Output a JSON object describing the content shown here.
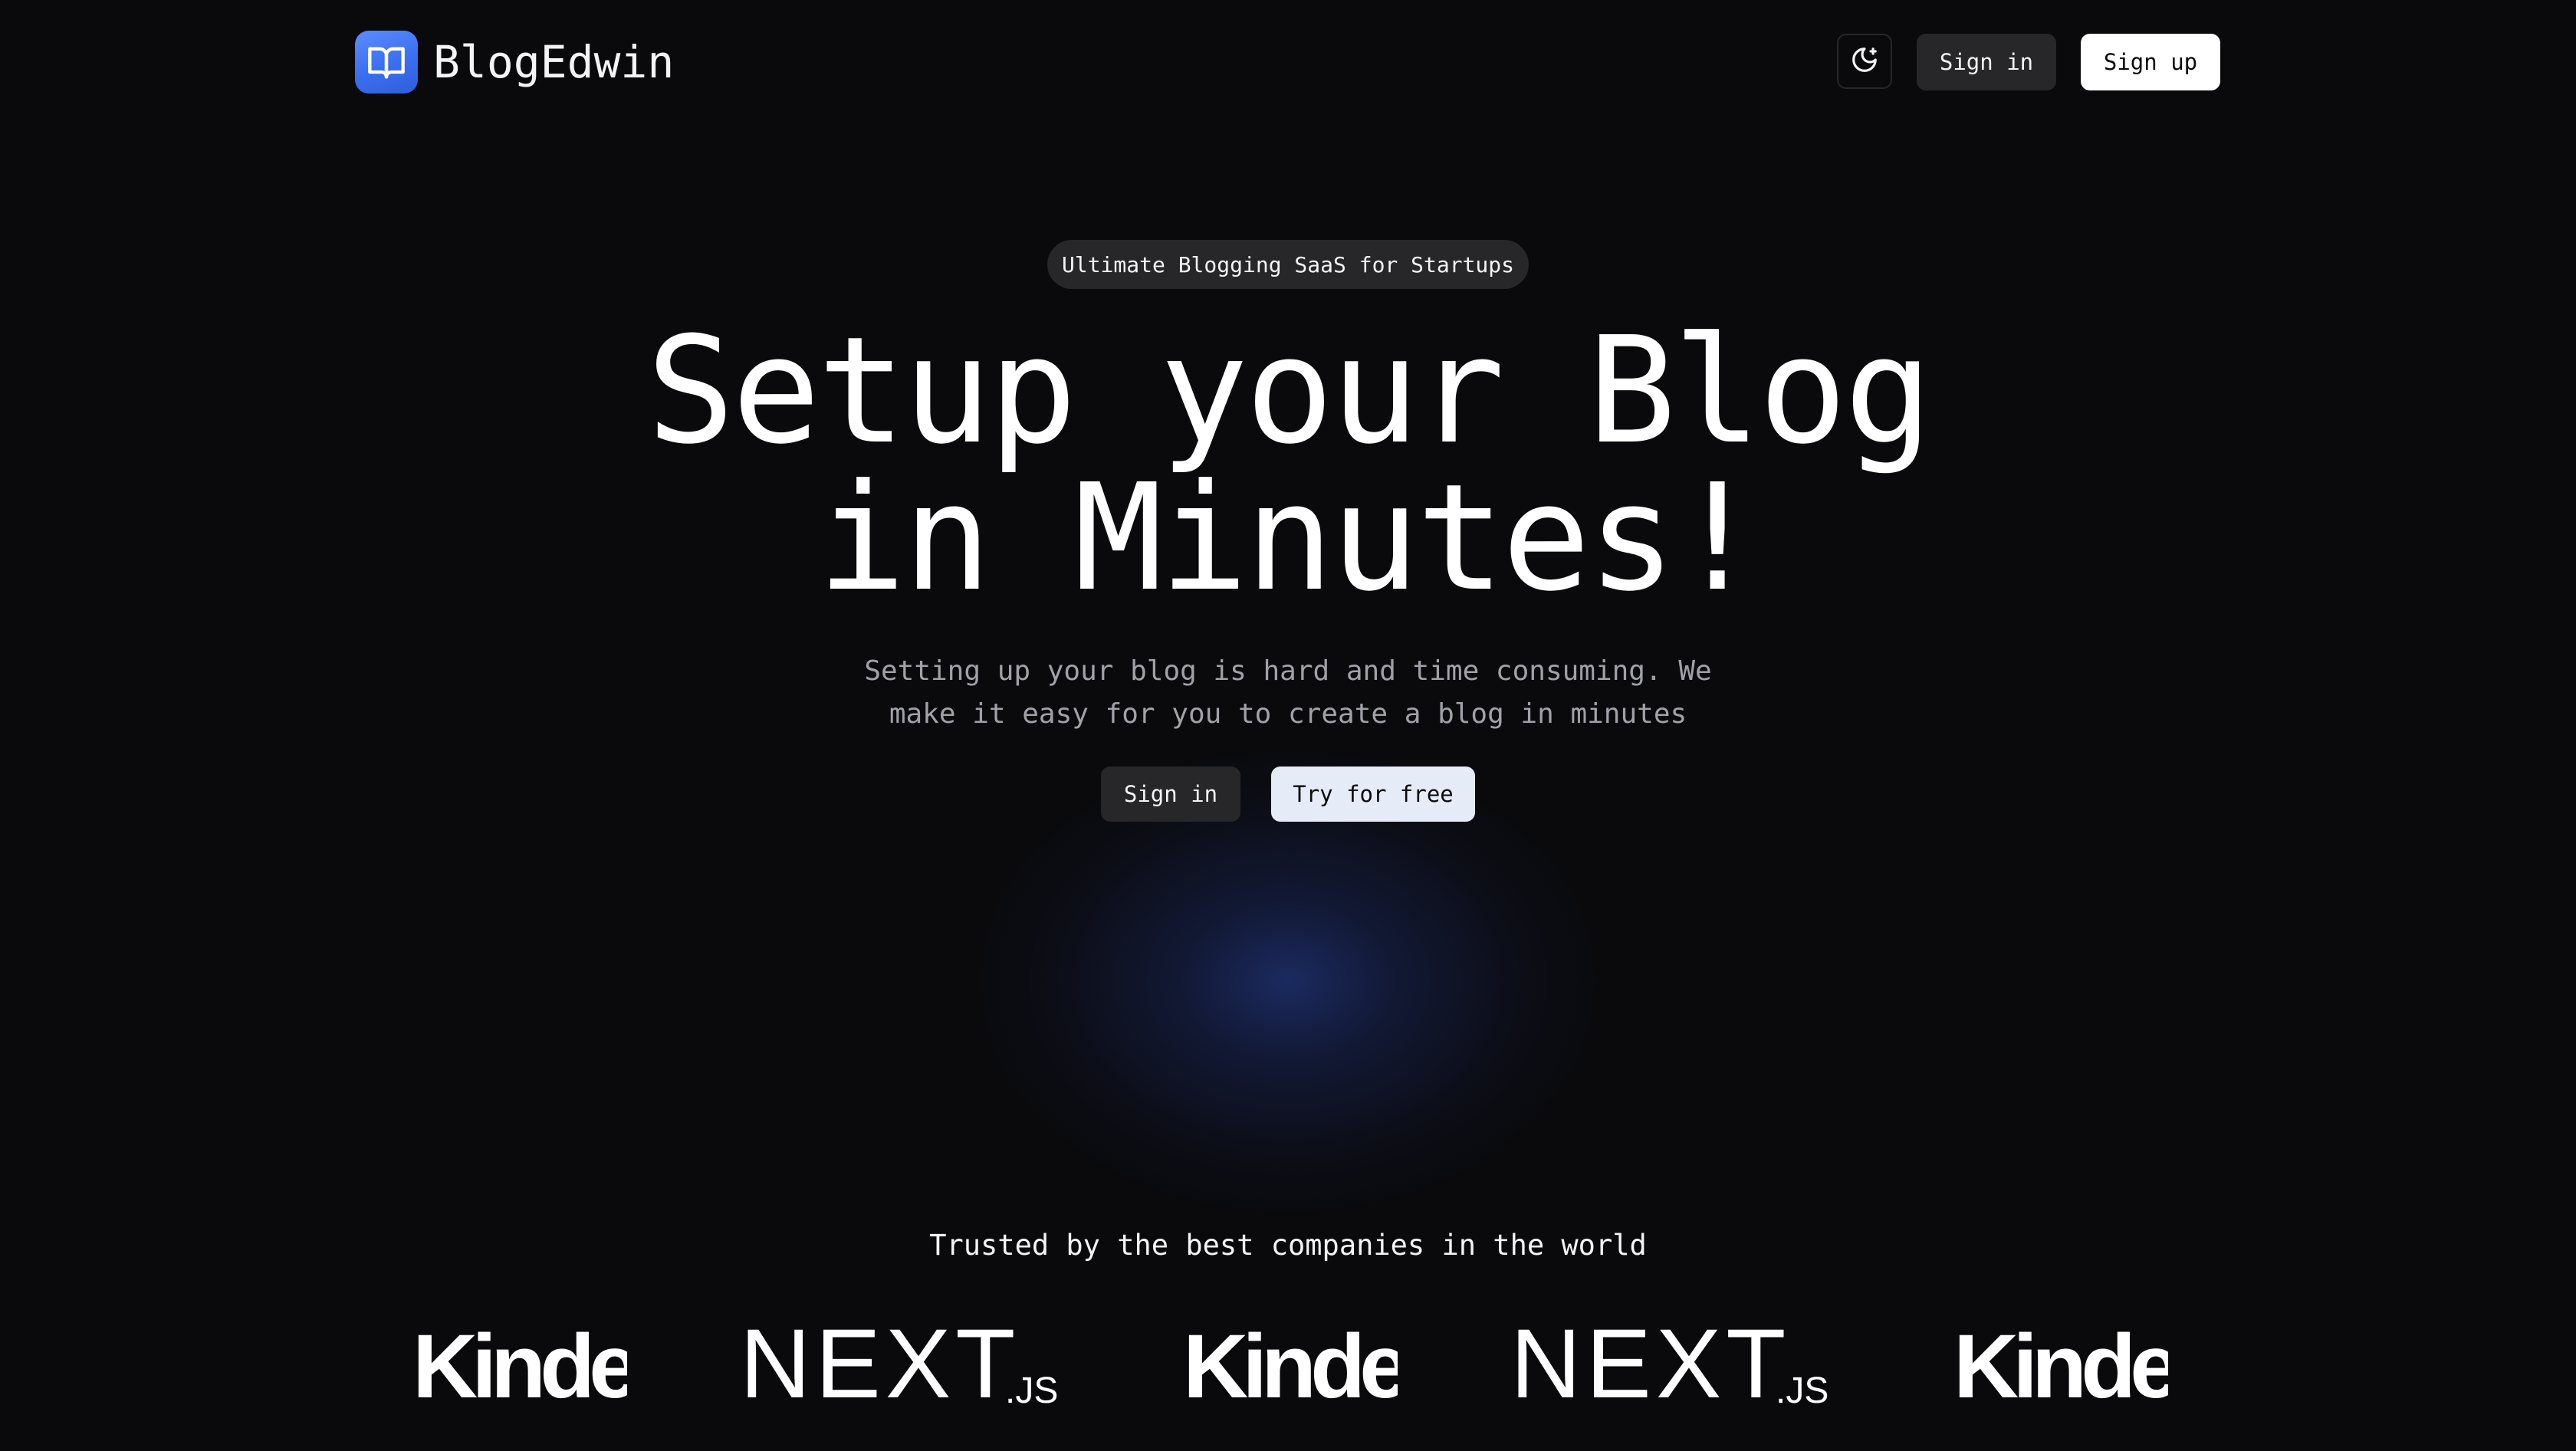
{
  "brand": {
    "name": "BlogEdwin",
    "logo_icon": "book-open-icon",
    "accent": "#3b6ef0"
  },
  "nav": {
    "theme_toggle_icon": "moon-stars-icon",
    "signin_label": "Sign in",
    "signup_label": "Sign up"
  },
  "hero": {
    "badge": "Ultimate Blogging SaaS for Startups",
    "headline_line1": "Setup your Blog",
    "headline_line2": "in Minutes!",
    "subtext": "Setting up your blog is hard and time consuming. We make it easy for you to create a blog in minutes",
    "signin_label": "Sign in",
    "try_label": "Try for free"
  },
  "trusted": {
    "heading": "Trusted by the best companies in the world",
    "logos": [
      {
        "name": "Kinde",
        "text": "Kinde"
      },
      {
        "name": "Next.js",
        "text": "NEXT",
        "suffix": ".JS"
      },
      {
        "name": "Kinde",
        "text": "Kinde"
      },
      {
        "name": "Next.js",
        "text": "NEXT",
        "suffix": ".JS"
      },
      {
        "name": "Kinde",
        "text": "Kinde"
      }
    ]
  },
  "colors": {
    "background": "#0a0a0c",
    "button_dark": "#27272a",
    "button_light": "#ffffff",
    "muted_text": "#a1a1aa"
  }
}
